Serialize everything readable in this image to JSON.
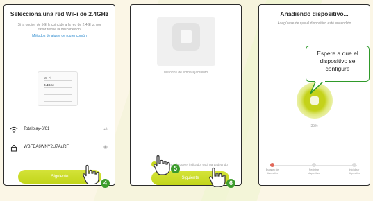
{
  "screen1": {
    "title": "Selecciona una red WiFi de 2.4GHz",
    "subtitle": "Si la opción de 5GHz coincide a la red de 2.4GHz, por favor revise la desconexión",
    "link": "Métodos de ajuste de router común",
    "router_rows": [
      "Wi-Fi",
      "2.4Ghz",
      "",
      ""
    ],
    "network_name": "Totalplay-6f61",
    "password": "WBFEA6WNY2U7AuRF",
    "next_button": "Siguiente",
    "step_badge": "4"
  },
  "screen2": {
    "caption": "Métodos de emparejamiento",
    "confirm_text": "He confirmado que el indicador está parpadeando",
    "next_button": "Siguiente",
    "step_badge_a": "5",
    "step_badge_b": "6"
  },
  "screen3": {
    "title": "Añadiendo dispositivo...",
    "subtitle": "Asegúrese de que el dispositivo esté encendido",
    "progress_text": "35%",
    "steps": [
      "Escaneo de dispositivo",
      "Registrar dispositivo",
      "Inicializar dispositivo"
    ]
  },
  "callout": {
    "text": [
      "Espere a que el",
      "dispositivo se",
      "configure"
    ]
  },
  "colors": {
    "accent": "#c7d81e",
    "badge": "#3c9c2c",
    "callout_border": "#2f9a2a"
  }
}
